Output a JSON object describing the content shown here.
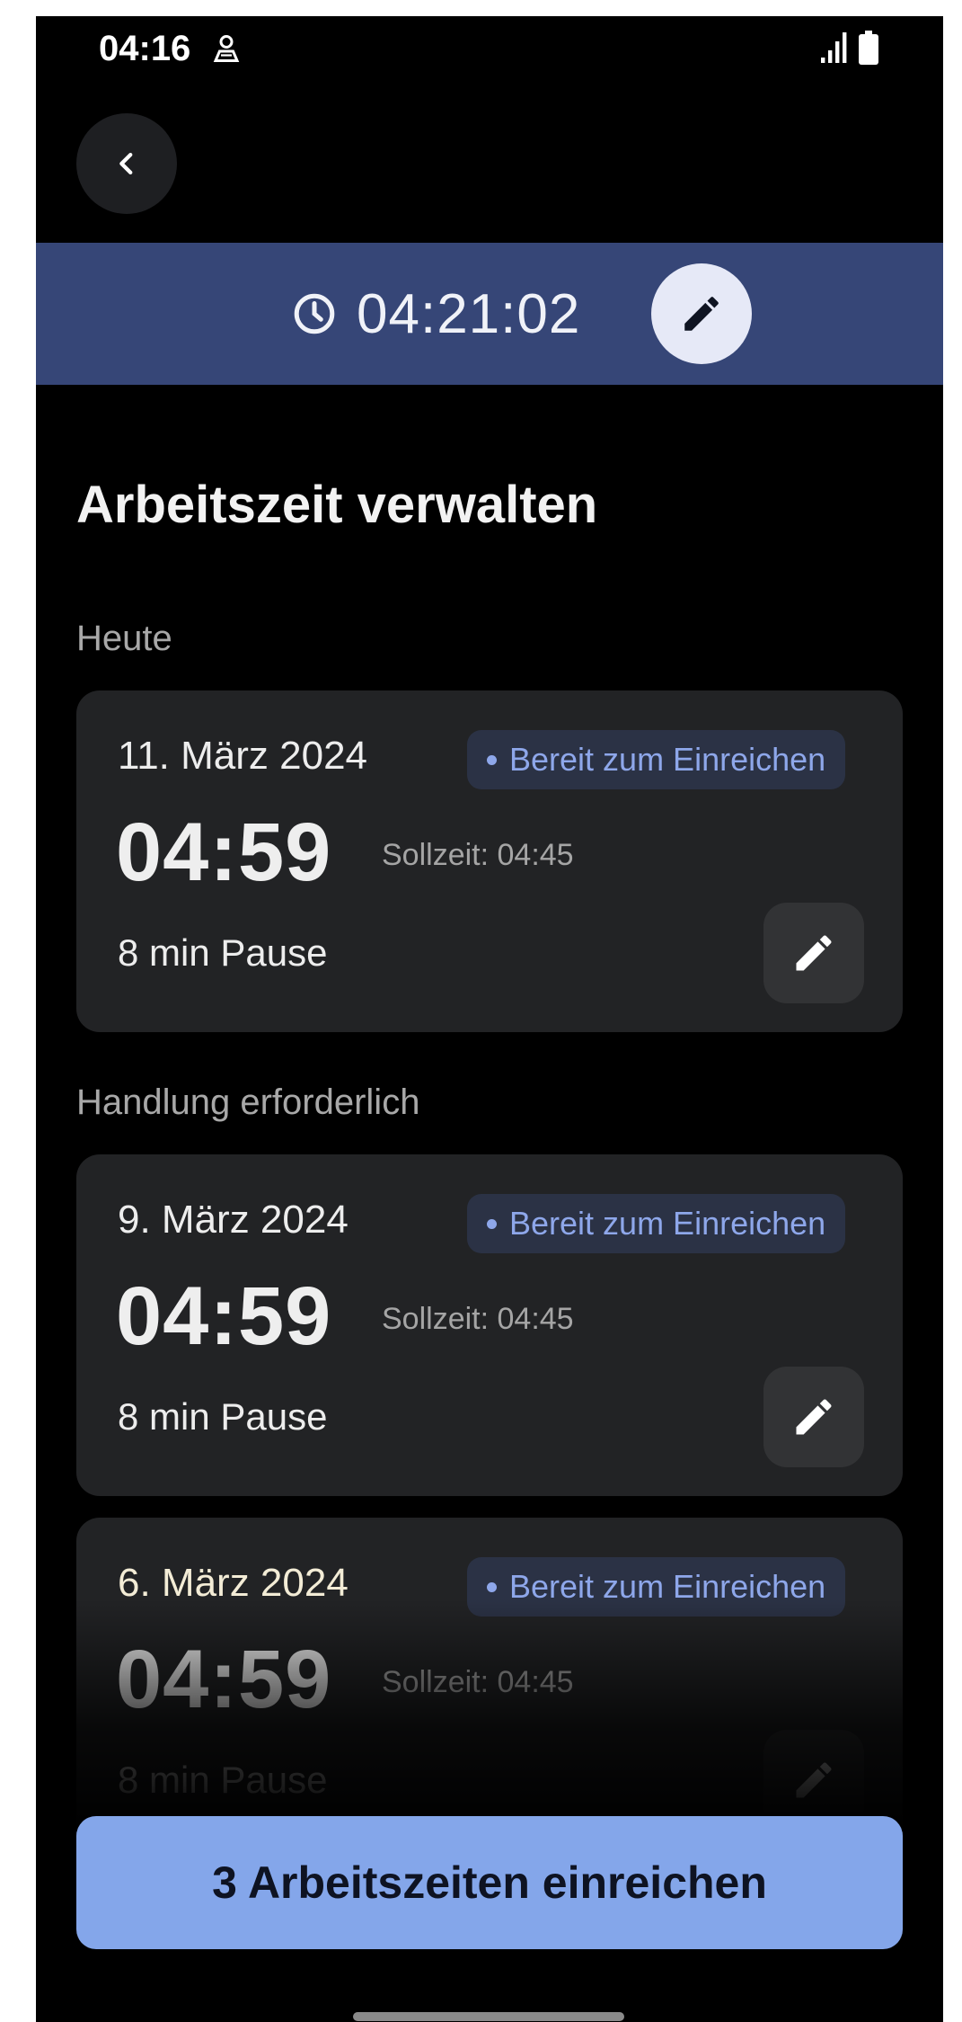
{
  "status_bar": {
    "time": "04:16",
    "person_icon": "person-location-icon",
    "signal_icon": "signal-icon",
    "battery_icon": "battery-icon"
  },
  "header": {
    "back_icon": "chevron-left-icon"
  },
  "timer": {
    "value": "04:21:02",
    "clock_icon": "clock-icon",
    "edit_icon": "pencil-icon"
  },
  "page": {
    "title": "Arbeitszeit verwalten"
  },
  "sections": [
    {
      "label": "Heute",
      "entries": [
        {
          "date": "11. März 2024",
          "status": "Bereit zum Einreichen",
          "hours": "04:59",
          "target": "Sollzeit: 04:45",
          "pause": "8 min Pause"
        }
      ]
    },
    {
      "label": "Handlung erforderlich",
      "entries": [
        {
          "date": "9. März 2024",
          "status": "Bereit zum Einreichen",
          "hours": "04:59",
          "target": "Sollzeit: 04:45",
          "pause": "8 min Pause"
        },
        {
          "date": "6. März 2024",
          "status": "Bereit zum Einreichen",
          "hours": "04:59",
          "target": "Sollzeit: 04:45",
          "pause": "8 min Pause"
        }
      ]
    }
  ],
  "submit_button": {
    "label": "3 Arbeitszeiten einreichen"
  },
  "colors": {
    "background": "#000000",
    "banner": "#364677",
    "card": "#222325",
    "accent": "#84a6ea",
    "badge_text": "#8ea7ea"
  }
}
